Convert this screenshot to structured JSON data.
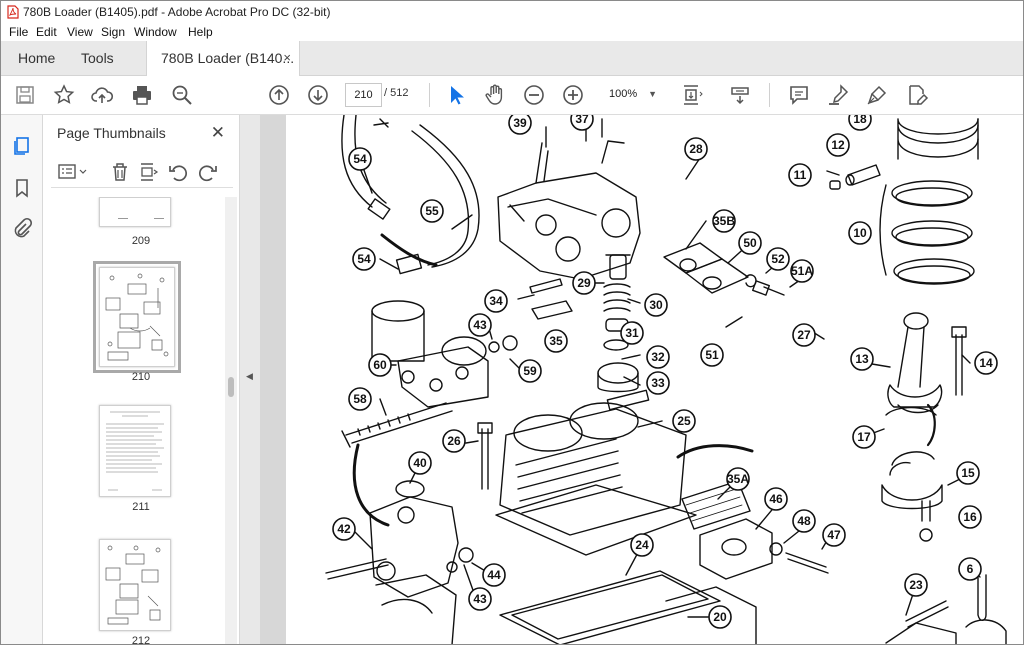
{
  "window": {
    "title": "780B Loader (B1405).pdf - Adobe Acrobat Pro DC (32-bit)"
  },
  "menu": [
    "File",
    "Edit",
    "View",
    "Sign",
    "Window",
    "Help"
  ],
  "tabs": {
    "home": "Home",
    "tools": "Tools",
    "document": "780B Loader (B140...",
    "close_symbol": "×"
  },
  "toolbar": {
    "current_page": "210",
    "page_total": "/ 512",
    "zoom": "100%"
  },
  "panel": {
    "title": "Page Thumbnails",
    "close_symbol": "✕",
    "thumbnails": [
      {
        "label": "209"
      },
      {
        "label": "210",
        "selected": true
      },
      {
        "label": "211"
      },
      {
        "label": "212"
      }
    ]
  },
  "diagram": {
    "callouts": [
      "39",
      "37",
      "18",
      "54",
      "28",
      "12",
      "11",
      "55",
      "35B",
      "10",
      "50",
      "54",
      "29",
      "52",
      "51A",
      "34",
      "30",
      "43",
      "31",
      "51",
      "27",
      "60",
      "59",
      "35",
      "32",
      "33",
      "13",
      "14",
      "58",
      "25",
      "26",
      "17",
      "40",
      "15",
      "35A",
      "46",
      "16",
      "42",
      "48",
      "47",
      "24",
      "44",
      "43",
      "23",
      "6",
      "20"
    ]
  },
  "colors": {
    "accent": "#1473e6",
    "pdf_red": "#d7281d",
    "tab_bg": "#e9e9e9"
  }
}
